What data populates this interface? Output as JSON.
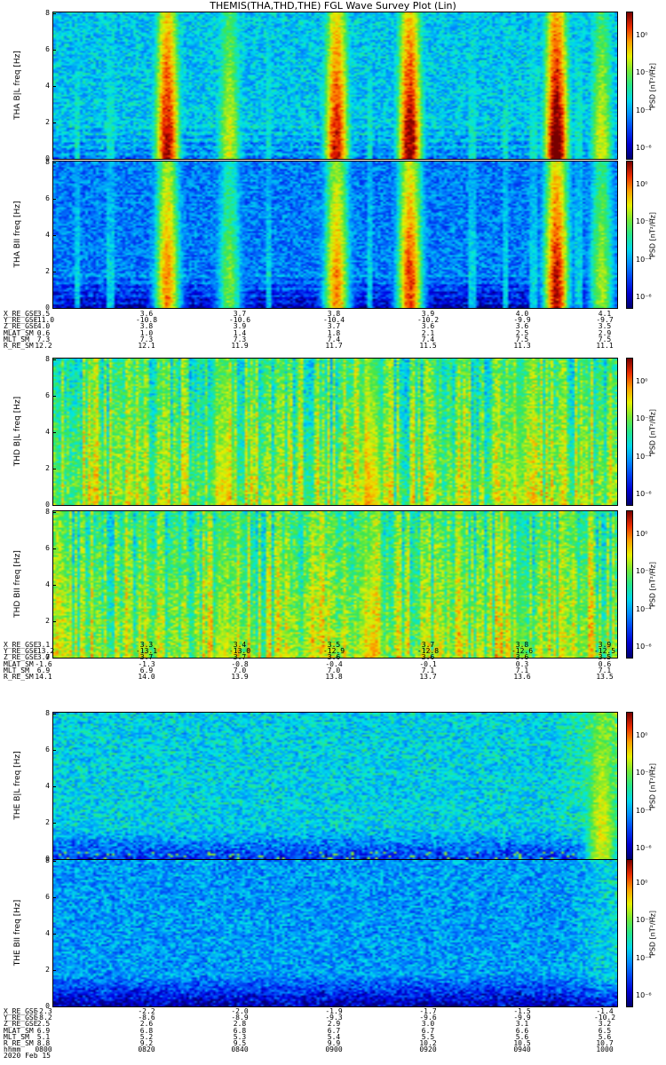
{
  "title": "THEMIS(THA,THD,THE) FGL Wave Survey Plot (Lin)",
  "colors": {
    "background": "#ffffff",
    "axis": "#000000"
  },
  "chart_data": {
    "type": "heatmap",
    "colormap": "rainbow (dark blue → blue → cyan → green → yellow → red → dark red)",
    "x_axis": {
      "label": "hhmm",
      "date": "2020 Feb 15",
      "ticks": [
        "0800",
        "0820",
        "0840",
        "0900",
        "0920",
        "0940",
        "1000"
      ]
    },
    "panels": [
      {
        "id": "tha_bl",
        "ylabel": "THA B|L",
        "yunit": "freq [Hz]",
        "ylim": [
          0,
          8
        ],
        "yticks": [
          "0",
          "2",
          "4",
          "6",
          "8"
        ],
        "cbar_label": "PSD [nT²/Hz]",
        "cbar_ticks": [
          "10⁰",
          "10⁻²",
          "10⁻⁴",
          "10⁻⁶"
        ],
        "texture": "bursts",
        "background_level": 0.38,
        "low_freq_dark": 0.1,
        "bursts": [
          0.2,
          0.31,
          0.5,
          0.63,
          0.89,
          0.97
        ],
        "burst_strength": [
          0.82,
          0.55,
          0.8,
          0.85,
          0.9,
          0.55
        ]
      },
      {
        "id": "tha_bii",
        "ylabel": "THA BII",
        "yunit": "freq [Hz]",
        "ylim": [
          0,
          8
        ],
        "yticks": [
          "0",
          "2",
          "4",
          "6",
          "8"
        ],
        "cbar_label": "PSD [nT²/Hz]",
        "cbar_ticks": [
          "10⁰",
          "10⁻²",
          "10⁻⁴",
          "10⁻⁶"
        ],
        "texture": "bursts",
        "background_level": 0.28,
        "low_freq_dark": 0.22,
        "bursts": [
          0.2,
          0.31,
          0.5,
          0.63,
          0.89,
          0.97
        ],
        "burst_strength": [
          0.72,
          0.5,
          0.72,
          0.8,
          0.85,
          0.55
        ]
      },
      {
        "id": "thd_bl",
        "ylabel": "THD B|L",
        "yunit": "freq [Hz]",
        "ylim": [
          0,
          8
        ],
        "yticks": [
          "0",
          "2",
          "4",
          "6",
          "8"
        ],
        "cbar_label": "PSD [nT²/Hz]",
        "cbar_ticks": [
          "10⁰",
          "10⁻²",
          "10⁻⁴",
          "10⁻⁶"
        ],
        "texture": "stripes",
        "background_level": 0.5,
        "low_freq_dark": 0.0,
        "bursts": [
          0.3,
          0.56,
          0.82,
          0.94
        ],
        "burst_strength": [
          0.5,
          0.55,
          0.45,
          0.4
        ]
      },
      {
        "id": "thd_bii",
        "ylabel": "THD BII",
        "yunit": "freq [Hz]",
        "ylim": [
          0,
          8
        ],
        "yticks": [
          "0",
          "2",
          "4",
          "6",
          "8"
        ],
        "cbar_label": "PSD [nT²/Hz]",
        "cbar_ticks": [
          "10⁰",
          "10⁻²",
          "10⁻⁴",
          "10⁻⁶"
        ],
        "texture": "stripes",
        "background_level": 0.52,
        "low_freq_dark": 0.0,
        "bursts": [
          0.3,
          0.56,
          0.82,
          0.94
        ],
        "burst_strength": [
          0.45,
          0.5,
          0.4,
          0.35
        ]
      },
      {
        "id": "the_bl",
        "ylabel": "THE B|L",
        "yunit": "freq [Hz]",
        "ylim": [
          0,
          8
        ],
        "yticks": [
          "0",
          "2",
          "4",
          "6",
          "8"
        ],
        "cbar_label": "PSD [nT²/Hz]",
        "cbar_ticks": [
          "10⁰",
          "10⁻²",
          "10⁻⁴",
          "10⁻⁶"
        ],
        "texture": "noise",
        "background_level": 0.4,
        "low_freq_dark": 0.25,
        "bursts": [
          0.97
        ],
        "burst_strength": [
          0.55
        ]
      },
      {
        "id": "the_bii",
        "ylabel": "THE BII",
        "yunit": "freq [Hz]",
        "ylim": [
          0,
          8
        ],
        "yticks": [
          "0",
          "2",
          "4",
          "6",
          "8"
        ],
        "cbar_label": "PSD [nT²/Hz]",
        "cbar_ticks": [
          "10⁰",
          "10⁻²",
          "10⁻⁴",
          "10⁻⁶"
        ],
        "texture": "noise",
        "background_level": 0.32,
        "low_freq_dark": 0.3,
        "bursts": [],
        "burst_strength": []
      }
    ],
    "ephemeris": [
      {
        "probe": "THA",
        "rows": [
          {
            "label": "X_RE_GSE",
            "values": [
              "3.5",
              "3.6",
              "3.7",
              "3.8",
              "3.9",
              "4.0",
              "4.1"
            ]
          },
          {
            "label": "Y_RE_GSE",
            "values": [
              "-11.0",
              "-10.8",
              "-10.6",
              "-10.4",
              "-10.2",
              "-9.9",
              "-9.7"
            ]
          },
          {
            "label": "Z_RE_GSE",
            "values": [
              "4.0",
              "3.8",
              "3.9",
              "3.7",
              "3.6",
              "3.6",
              "3.5"
            ]
          },
          {
            "label": "MLAT_SM",
            "values": [
              "0.6",
              "1.0",
              "1.4",
              "1.8",
              "2.1",
              "2.5",
              "2.9"
            ]
          },
          {
            "label": "MLT_SM",
            "values": [
              "7.3",
              "7.3",
              "7.3",
              "7.4",
              "7.4",
              "7.5",
              "7.5"
            ]
          },
          {
            "label": "R_RE_SM",
            "values": [
              "12.2",
              "12.1",
              "11.9",
              "11.7",
              "11.5",
              "11.3",
              "11.1"
            ]
          }
        ]
      },
      {
        "probe": "THD",
        "rows": [
          {
            "label": "X_RE_GSE",
            "values": [
              "3.1",
              "3.3",
              "3.4",
              "3.5",
              "3.7",
              "3.8",
              "3.9"
            ]
          },
          {
            "label": "Y_RE_GSE",
            "values": [
              "-13.2",
              "-13.1",
              "-13.0",
              "-12.9",
              "-12.8",
              "-12.6",
              "-12.5"
            ]
          },
          {
            "label": "Z_RE_GSE",
            "values": [
              "3.7",
              "3.7",
              "3.7",
              "3.6",
              "3.6",
              "3.6",
              "3.5"
            ]
          },
          {
            "label": "MLAT_SM",
            "values": [
              "-1.6",
              "-1.3",
              "-0.8",
              "-0.4",
              "-0.1",
              "0.3",
              "0.6"
            ]
          },
          {
            "label": "MLT_SM",
            "values": [
              "6.9",
              "6.9",
              "7.0",
              "7.0",
              "7.1",
              "7.1",
              "7.1"
            ]
          },
          {
            "label": "R_RE_SM",
            "values": [
              "14.1",
              "14.0",
              "13.9",
              "13.8",
              "13.7",
              "13.6",
              "13.5"
            ]
          }
        ]
      },
      {
        "probe": "THE",
        "rows": [
          {
            "label": "X_RE_GSE",
            "values": [
              "-2.3",
              "-2.2",
              "-2.0",
              "-1.9",
              "-1.7",
              "-1.5",
              "-1.4"
            ]
          },
          {
            "label": "Y_RE_GSE",
            "values": [
              "-8.2",
              "-8.6",
              "-8.9",
              "-9.3",
              "-9.6",
              "-9.9",
              "-10.2"
            ]
          },
          {
            "label": "Z_RE_GSE",
            "values": [
              "2.5",
              "2.6",
              "2.8",
              "2.9",
              "3.0",
              "3.1",
              "3.2"
            ]
          },
          {
            "label": "MLAT_SM",
            "values": [
              "6.9",
              "6.8",
              "6.8",
              "6.7",
              "6.7",
              "6.6",
              "6.5"
            ]
          },
          {
            "label": "MLT_SM",
            "values": [
              "5.1",
              "5.2",
              "5.3",
              "5.4",
              "5.5",
              "5.6",
              "5.6"
            ]
          },
          {
            "label": "R_RE_SM",
            "values": [
              "8.8",
              "9.2",
              "9.5",
              "9.9",
              "10.2",
              "10.5",
              "10.7"
            ]
          }
        ]
      }
    ]
  }
}
